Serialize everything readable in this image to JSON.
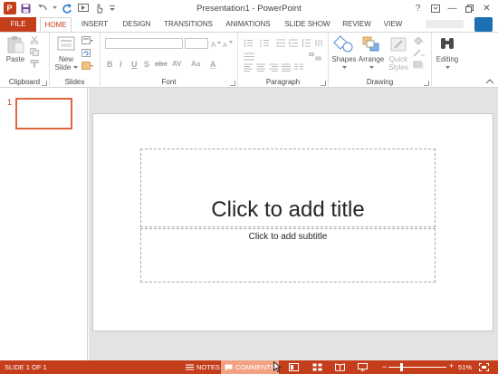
{
  "window": {
    "title": "Presentation1 - PowerPoint"
  },
  "tabs": [
    {
      "label": "FILE"
    },
    {
      "label": "HOME"
    },
    {
      "label": "INSERT"
    },
    {
      "label": "DESIGN"
    },
    {
      "label": "TRANSITIONS"
    },
    {
      "label": "ANIMATIONS"
    },
    {
      "label": "SLIDE SHOW"
    },
    {
      "label": "REVIEW"
    },
    {
      "label": "VIEW"
    }
  ],
  "ribbon": {
    "clipboard": {
      "label": "Clipboard",
      "paste": "Paste"
    },
    "slides": {
      "label": "Slides",
      "new_slide_line1": "New",
      "new_slide_line2": "Slide"
    },
    "font": {
      "label": "Font"
    },
    "paragraph": {
      "label": "Paragraph"
    },
    "drawing": {
      "label": "Drawing",
      "shapes": "Shapes",
      "arrange": "Arrange",
      "quick_styles_line1": "Quick",
      "quick_styles_line2": "Styles"
    },
    "editing": {
      "label": "Editing"
    },
    "format_letters": [
      "B",
      "I",
      "U",
      "S",
      "abc",
      "AV",
      "Aa",
      "A"
    ]
  },
  "thumbnails": {
    "slide_number": "1"
  },
  "slide": {
    "title_placeholder": "Click to add title",
    "subtitle_placeholder": "Click to add subtitle"
  },
  "status": {
    "slide_info": "SLIDE 1 OF 1",
    "notes": "NOTES",
    "comments": "COMMENTS",
    "zoom": "51%",
    "zoom_fraction": 0.51
  },
  "colors": {
    "accent": "#c43e1c"
  }
}
